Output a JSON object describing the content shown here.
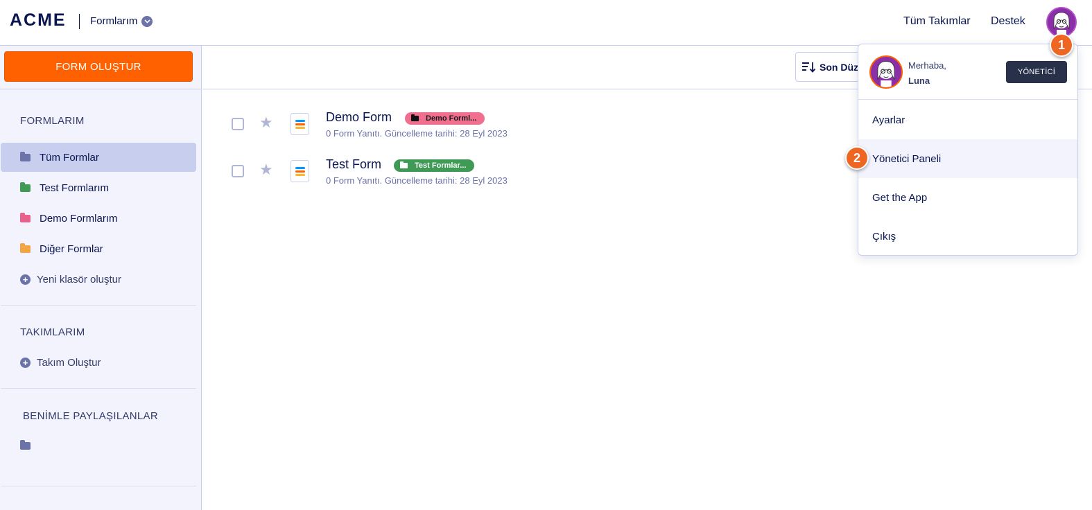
{
  "header": {
    "logo": "ACME",
    "product_name": "Formlarım",
    "nav": [
      "Tüm Takımlar",
      "Destek"
    ]
  },
  "sidebar": {
    "create_button": "FORM OLUŞTUR",
    "forms_title": "FORMLARIM",
    "folders": [
      {
        "label": "Tüm Formlar",
        "color": "#6c73a8"
      },
      {
        "label": "Test Formlarım",
        "color": "#3f9a56"
      },
      {
        "label": "Demo Formlarım",
        "color": "#e8618c"
      },
      {
        "label": "Diğer Formlar",
        "color": "#f2a541"
      }
    ],
    "new_folder": "Yeni klasör oluştur",
    "teams_title": "TAKIMLARIM",
    "create_team": "Takım Oluştur",
    "shared_title": "BENİMLE PAYLAŞILANLAR"
  },
  "toolbar": {
    "sort_label": "Son Düz"
  },
  "forms": [
    {
      "title": "Demo Form",
      "tag": "Demo Forml...",
      "tag_color": "#f06f8e",
      "meta": "0 Form Yanıtı. Güncelleme tarihi: 28 Eyl 2023"
    },
    {
      "title": "Test Form",
      "tag": "Test Formlar...",
      "tag_color": "#3f9a56",
      "meta": "0 Form Yanıtı. Güncelleme tarihi: 28 Eyl 2023"
    }
  ],
  "user_menu": {
    "greeting": "Merhaba,",
    "name": "Luna",
    "role": "YÖNETİCİ",
    "items": [
      "Ayarlar",
      "Yönetici Paneli",
      "Get the App",
      "Çıkış"
    ]
  },
  "steps": [
    "1",
    "2"
  ]
}
